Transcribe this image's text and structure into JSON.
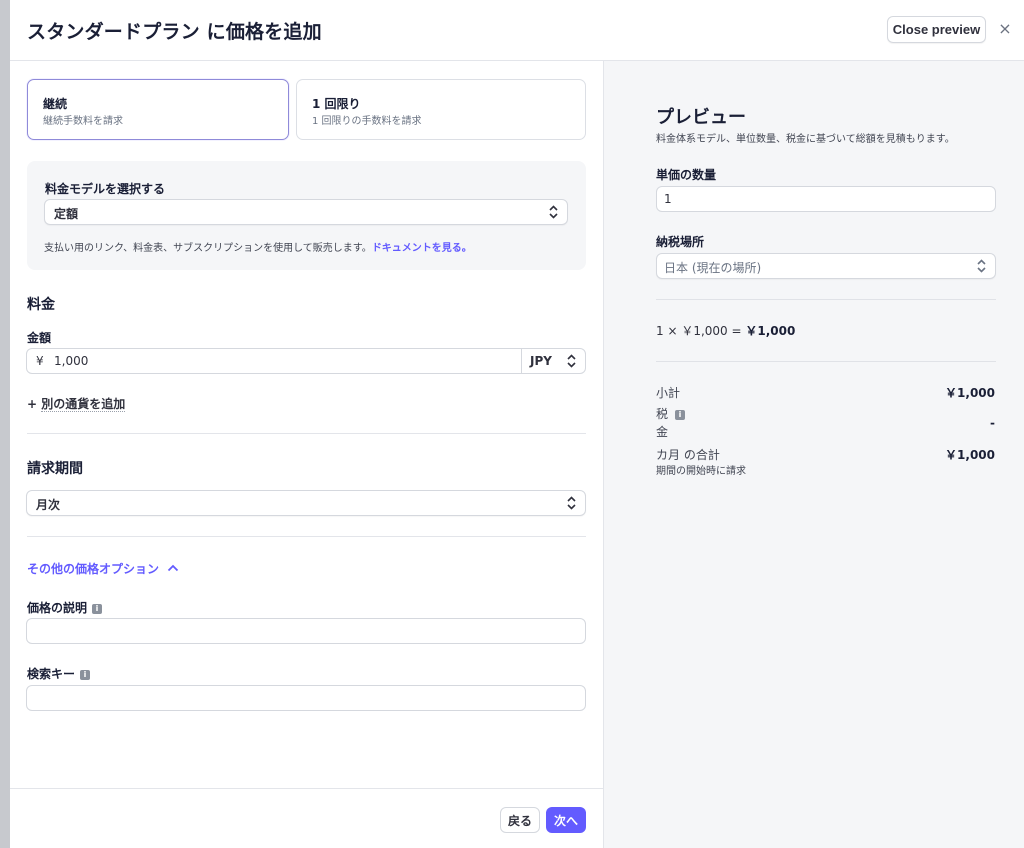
{
  "modal": {
    "title": "スタンダードプラン に価格を追加",
    "close_preview_label": "Close preview",
    "close_icon": "×"
  },
  "pricing_type": {
    "options": [
      {
        "title": "継続",
        "subtitle": "継続手数料を請求",
        "selected": true
      },
      {
        "title": "1 回限り",
        "subtitle": "1 回限りの手数料を請求",
        "selected": false
      }
    ]
  },
  "pricing_model": {
    "label": "料金モデルを選択する",
    "selected": "定額",
    "helper_text": "支払い用のリンク、料金表、サブスクリプションを使用して販売します。",
    "helper_link": "ドキュメントを見る。"
  },
  "price": {
    "section_title": "料金",
    "amount_label": "金額",
    "currency_symbol": "¥",
    "amount_value": "1,000",
    "currency": "JPY",
    "add_currency_label": "別の通貨を追加"
  },
  "billing": {
    "section_title": "請求期間",
    "selected": "月次"
  },
  "more_options": {
    "toggle_label": "その他の価格オプション",
    "price_description_label": "価格の説明",
    "price_description_value": "",
    "lookup_key_label": "検索キー",
    "lookup_key_value": ""
  },
  "footer": {
    "back_label": "戻る",
    "next_label": "次へ"
  },
  "preview": {
    "title": "プレビュー",
    "subtitle": "料金体系モデル、単位数量、税金に基づいて総額を見積もります。",
    "quantity_label": "単価の数量",
    "quantity_value": "1",
    "tax_location_label": "納税場所",
    "tax_location_value": "日本 (現在の場所)",
    "calc_prefix": "1 × ￥1,000 = ",
    "calc_total": "￥1,000",
    "subtotal_label": "小計",
    "subtotal_value": "￥1,000",
    "tax_label_line1": "税",
    "tax_label_line2": "金",
    "tax_value": "-",
    "total_label": "カ月 の合計",
    "total_value": "￥1,000",
    "total_note": "期間の開始時に請求"
  },
  "colors": {
    "accent": "#635bff",
    "selected_border": "#8f8ad9",
    "preview_bg": "#f5f6f8"
  }
}
